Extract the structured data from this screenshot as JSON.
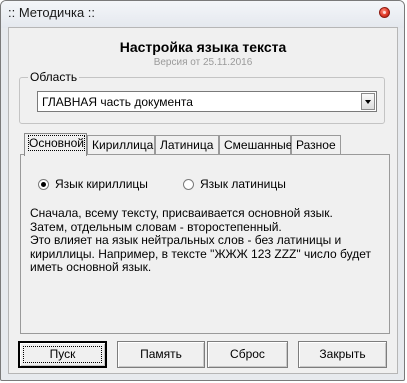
{
  "window": {
    "title": ":: Методичка ::"
  },
  "header": {
    "title": "Настройка языка текста",
    "version": "Версия от  25.11.2016"
  },
  "area": {
    "label": "Область",
    "selected": "ГЛАВНАЯ часть документа"
  },
  "tabs": [
    {
      "label": "Основной",
      "active": true
    },
    {
      "label": "Кириллица",
      "active": false
    },
    {
      "label": "Латиница",
      "active": false
    },
    {
      "label": "Смешанные",
      "active": false
    },
    {
      "label": "Разное",
      "active": false
    }
  ],
  "main_tab": {
    "radio_cyrillic": {
      "label": "Язык кириллицы",
      "checked": true
    },
    "radio_latin": {
      "label": "Язык латиницы",
      "checked": false
    },
    "description": [
      "Сначала, всему тексту, присваивается основной язык.",
      "Затем, отдельным словам - второстепенный.",
      "Это влияет на язык нейтральных слов - без латиницы и",
      "кириллицы. Например, в тексте \"ЖЖЖ 123 ZZZ\" число будет",
      "иметь основной язык."
    ]
  },
  "buttons": {
    "start": "Пуск",
    "memory": "Память",
    "reset": "Сброс",
    "close": "Закрыть"
  }
}
